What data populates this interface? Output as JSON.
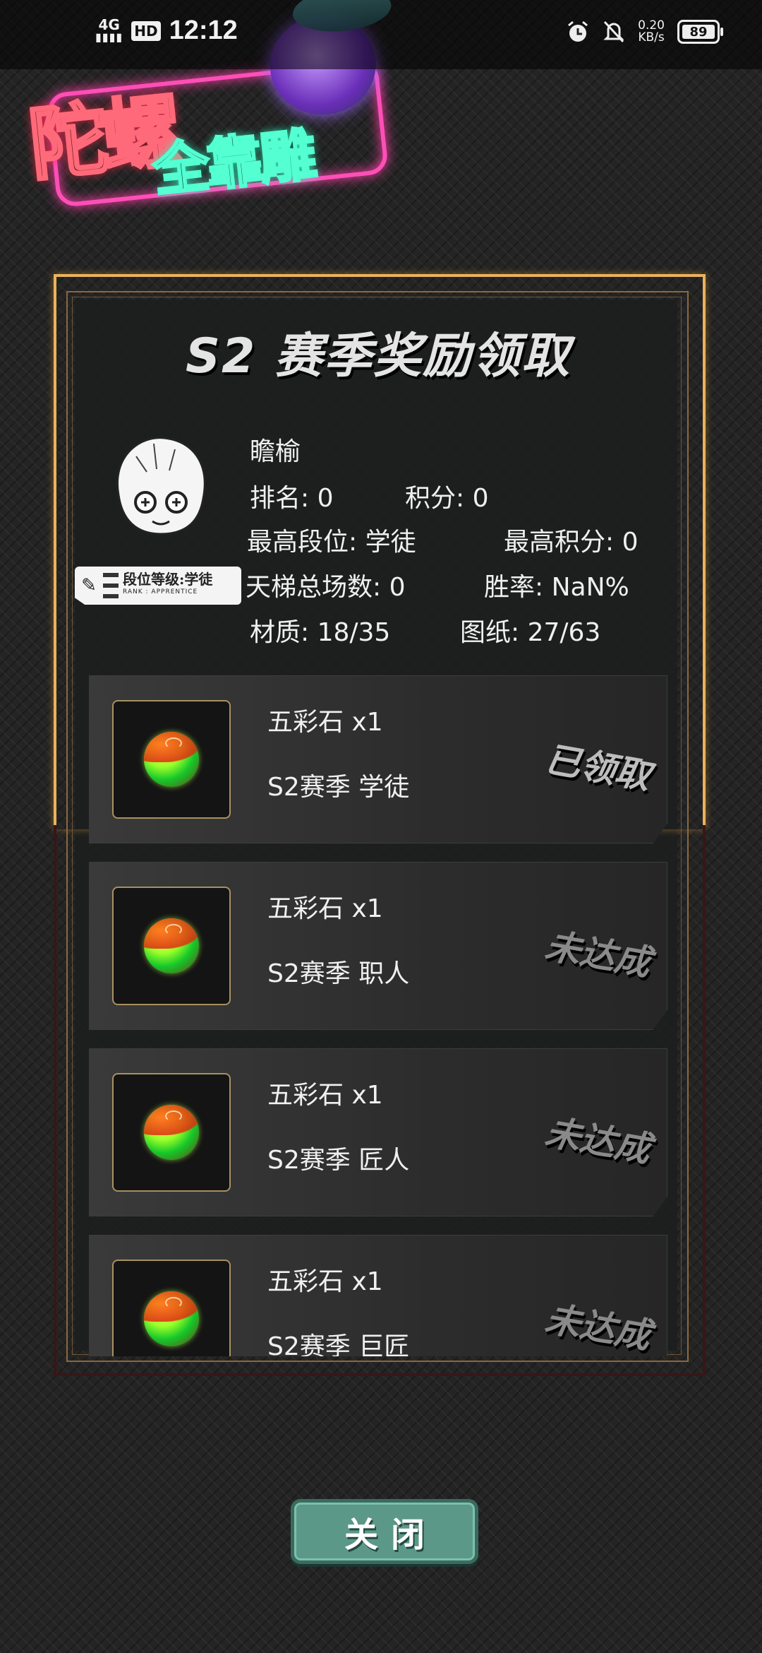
{
  "status_bar": {
    "network": "4G",
    "hd_badge": "HD",
    "time": "12:12",
    "speed_value": "0.20",
    "speed_unit": "KB/s",
    "battery": "89"
  },
  "logo": {
    "line1": "陀螺",
    "line2": "全靠雕"
  },
  "panel": {
    "title": "S2 赛季奖励领取"
  },
  "profile": {
    "name": "瞻榆",
    "rank_badge": {
      "text": "段位等级:学徒",
      "subtext": "RANK : APPRENTICE"
    },
    "rank": "排名: 0",
    "score": "积分: 0",
    "highest_tier": "最高段位: 学徒",
    "highest_score": "最高积分: 0",
    "ladder_total": "天梯总场数: 0",
    "win_rate": "胜率: NaN%",
    "materials": "材质: 18/35",
    "blueprints": "图纸: 27/63"
  },
  "rewards": [
    {
      "name": "五彩石 x1",
      "tier": "S2赛季 学徒",
      "status": "已领取",
      "icon": "five-color-stone"
    },
    {
      "name": "五彩石 x1",
      "tier": "S2赛季 职人",
      "status": "未达成",
      "icon": "five-color-stone"
    },
    {
      "name": "五彩石 x1",
      "tier": "S2赛季 匠人",
      "status": "未达成",
      "icon": "five-color-stone"
    },
    {
      "name": "五彩石 x1",
      "tier": "S2赛季 巨匠",
      "status": "未达成",
      "icon": "five-color-stone"
    }
  ],
  "close_button": {
    "label": "关闭"
  },
  "colors": {
    "gold_frame": "#e9b35c",
    "button": "#5c9888",
    "neon_pink": "#ff4fb7",
    "neon_teal": "#54ffd2"
  }
}
